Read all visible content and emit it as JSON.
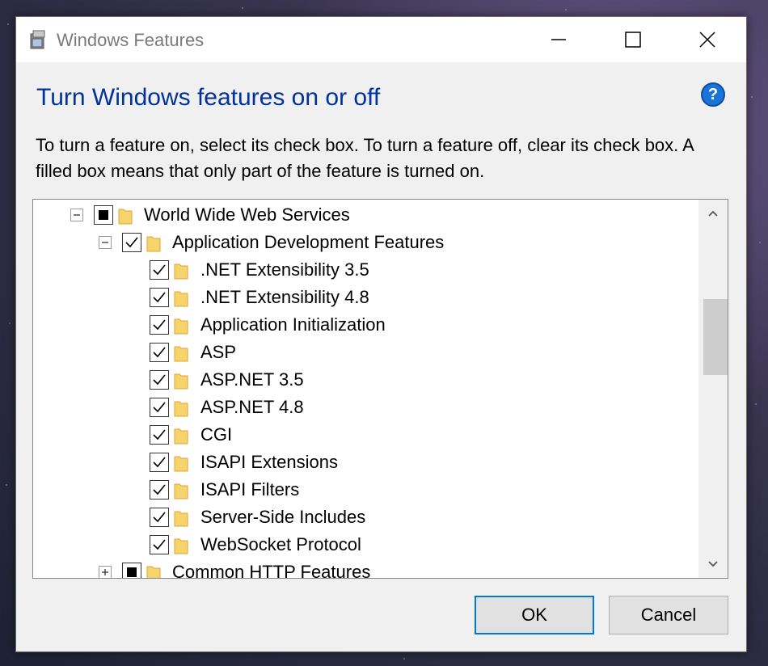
{
  "window": {
    "title": "Windows Features",
    "minimize_icon": "minimize-icon",
    "maximize_icon": "maximize-icon",
    "close_icon": "close-icon"
  },
  "heading": "Turn Windows features on or off",
  "help": {
    "label": "?",
    "icon": "help-icon"
  },
  "description": "To turn a feature on, select its check box. To turn a feature off, clear its check box. A filled box means that only part of the feature is turned on.",
  "tree": {
    "items": [
      {
        "label": "World Wide Web Services",
        "state": "partial",
        "expander": "collapse"
      },
      {
        "label": "Application Development Features",
        "state": "checked",
        "expander": "collapse"
      },
      {
        "label": ".NET Extensibility 3.5",
        "state": "checked"
      },
      {
        "label": ".NET Extensibility 4.8",
        "state": "checked"
      },
      {
        "label": "Application Initialization",
        "state": "checked"
      },
      {
        "label": "ASP",
        "state": "checked"
      },
      {
        "label": "ASP.NET 3.5",
        "state": "checked"
      },
      {
        "label": "ASP.NET 4.8",
        "state": "checked"
      },
      {
        "label": "CGI",
        "state": "checked"
      },
      {
        "label": "ISAPI Extensions",
        "state": "checked"
      },
      {
        "label": "ISAPI Filters",
        "state": "checked"
      },
      {
        "label": "Server-Side Includes",
        "state": "checked"
      },
      {
        "label": "WebSocket Protocol",
        "state": "checked"
      },
      {
        "label": "Common HTTP Features",
        "state": "partial",
        "expander": "expand"
      }
    ]
  },
  "buttons": {
    "ok": "OK",
    "cancel": "Cancel"
  },
  "colors": {
    "heading": "#003399",
    "accent": "#0078d7",
    "folder": "#f7d36b"
  }
}
